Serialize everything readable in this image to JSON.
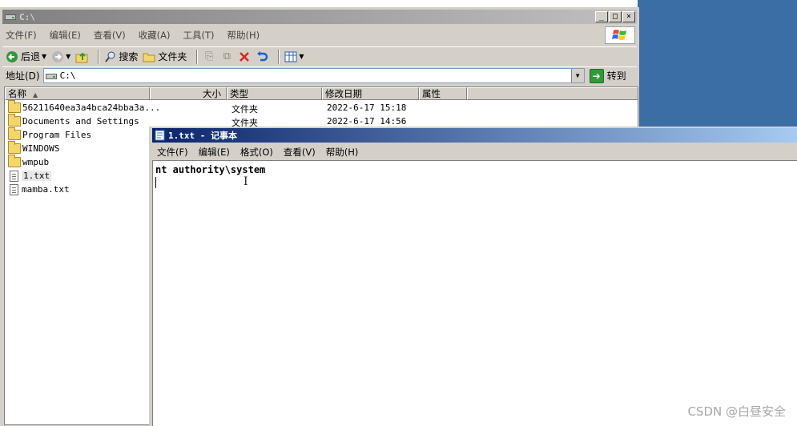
{
  "explorer": {
    "title": "C:\\",
    "window_buttons": [
      "_",
      "□",
      "×"
    ],
    "menu": [
      "文件(F)",
      "编辑(E)",
      "查看(V)",
      "收藏(A)",
      "工具(T)",
      "帮助(H)"
    ],
    "toolbar": {
      "back_label": "后退",
      "search_label": "搜索",
      "folders_label": "文件夹"
    },
    "address": {
      "label": "地址(D)",
      "value": "C:\\",
      "go_label": "转到"
    },
    "columns": [
      "名称",
      "大小",
      "类型",
      "修改日期",
      "属性"
    ],
    "files": [
      {
        "name": "56211640ea3a4bca24bba3a...",
        "type": "文件夹",
        "modified": "2022-6-17 15:18",
        "kind": "folder"
      },
      {
        "name": "Documents and Settings",
        "type": "文件夹",
        "modified": "2022-6-17 14:56",
        "kind": "folder"
      },
      {
        "name": "Program Files",
        "type": "",
        "modified": "",
        "kind": "folder"
      },
      {
        "name": "WINDOWS",
        "type": "",
        "modified": "",
        "kind": "folder"
      },
      {
        "name": "wmpub",
        "type": "",
        "modified": "",
        "kind": "folder"
      },
      {
        "name": "1.txt",
        "type": "",
        "modified": "",
        "kind": "txt"
      },
      {
        "name": "mamba.txt",
        "type": "",
        "modified": "",
        "kind": "txt"
      }
    ]
  },
  "notepad": {
    "title": "1.txt - 记事本",
    "menu": [
      "文件(F)",
      "编辑(E)",
      "格式(O)",
      "查看(V)",
      "帮助(H)"
    ],
    "content": "nt authority\\system"
  },
  "watermark": "CSDN @白昼安全",
  "colors": {
    "active_title": "#0a246a",
    "inactive_title": "#808080",
    "desktop": "#3a6ea5",
    "chrome": "#d4d0c8"
  }
}
